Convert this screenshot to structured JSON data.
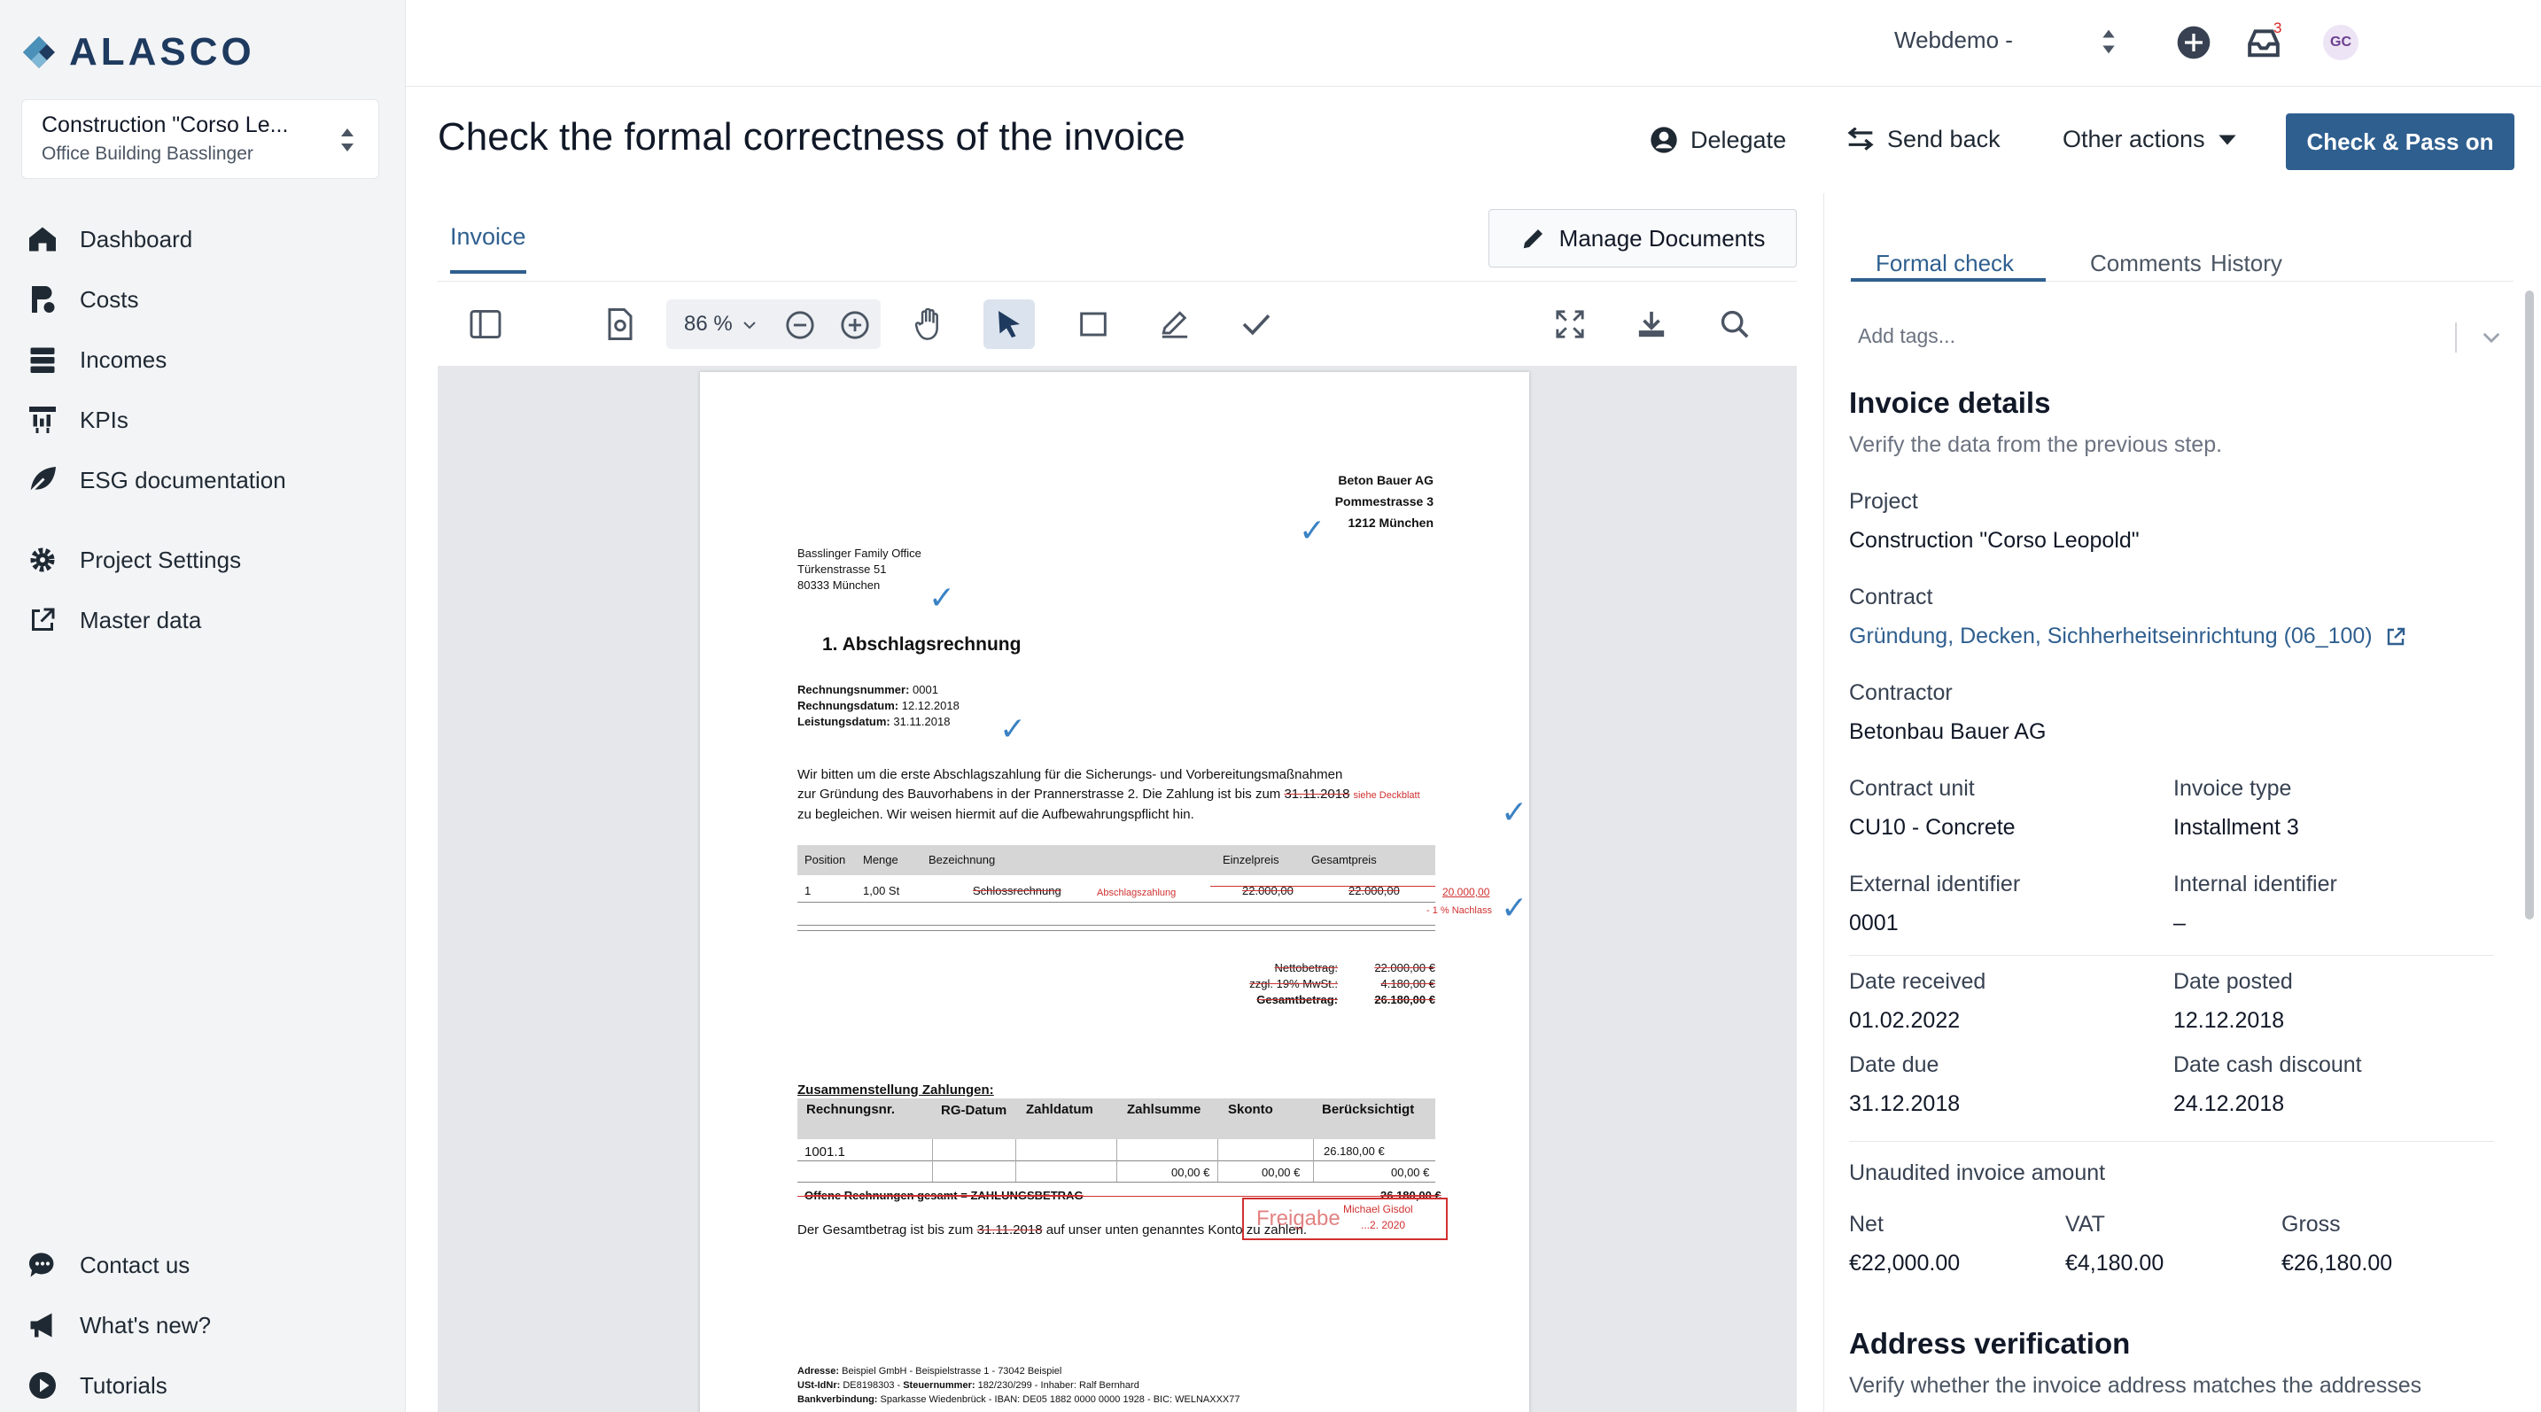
{
  "app": {
    "logo_text": "ALASCO"
  },
  "project": {
    "title": "Construction \"Corso Le...",
    "subtitle": "Office Building Basslinger"
  },
  "nav": {
    "dashboard": "Dashboard",
    "costs": "Costs",
    "incomes": "Incomes",
    "kpis": "KPIs",
    "esg": "ESG documentation",
    "settings": "Project Settings",
    "master": "Master data",
    "contact": "Contact us",
    "whatsnew": "What's new?",
    "tutorials": "Tutorials"
  },
  "topbar": {
    "workspace": "Webdemo -",
    "notification_count": "3",
    "avatar_initials": "GC"
  },
  "header": {
    "title": "Check the formal correctness of the invoice",
    "delegate": "Delegate",
    "send_back": "Send back",
    "other_actions": "Other actions",
    "primary": "Check & Pass on"
  },
  "doc": {
    "tab": "Invoice",
    "manage": "Manage Documents",
    "zoom": "86 %"
  },
  "invoice": {
    "sender": [
      "Beton Bauer AG",
      "Pommestrasse 3",
      "1212 München"
    ],
    "recipient": [
      "Basslinger Family Office",
      "Türkenstrasse 51",
      "80333 München"
    ],
    "heading": "1.  Abschlagsrechnung",
    "meta": [
      {
        "k": "Rechnungsnummer:",
        "v": " 0001"
      },
      {
        "k": "Rechnungsdatum:",
        "v": " 12.12.2018"
      },
      {
        "k": "Leistungsdatum:",
        "v": " 31.11.2018"
      }
    ],
    "body": [
      "Wir bitten um die erste Abschlagszahlung für die Sicherungs- und Vorbereitungsmaßnahmen",
      "zur Gründung des Bauvorhabens in der Prannerstrasse 2. Die Zahlung ist bis zum ",
      "zu begleichen. Wir weisen hiermit auf die Aufbewahrungspflicht hin."
    ],
    "due_struck": "31.11.2018",
    "note_deckblatt": "siehe Deckblatt",
    "table_headers": [
      "Position",
      "Menge",
      "Bezeichnung",
      "Einzelpreis",
      "Gesamtpreis"
    ],
    "row": [
      "1",
      "1,00 St",
      "Schlossrechnung",
      "22.000,00",
      "22.000,00"
    ],
    "row_annot": "Abschlagszahlung",
    "corr_amount": "20.000,00",
    "corr_note": "- 1 % Nachlass",
    "totals": [
      {
        "k": "Nettobetrag:",
        "v": "22.000,00 €"
      },
      {
        "k": "zzgl. 19% MwSt.:",
        "v": "4.180,00 €"
      },
      {
        "k": "Gesamtbetrag:",
        "v": "26.180,00 €"
      }
    ],
    "summary_title": "Zusammenstellung Zahlungen:",
    "summary_headers": [
      "Rechnungsnr.",
      "RG-Datum",
      "Zahldatum",
      "Zahlsumme",
      "Skonto",
      "Berücksichtigt"
    ],
    "summary_row1": [
      "1001.1",
      "26.180,00 €"
    ],
    "summary_row2": [
      "00,00 €",
      "00,00 €",
      "00,00 €"
    ],
    "open_total_label": "Offene Rechnungen gesamt = ZAHLUNGSBETRAG",
    "open_total_value": "26.180,00 €",
    "closing_1": "Der Gesamtbetrag ist bis zum ",
    "closing_date": "31.11.2018",
    "closing_2": " auf unser unten genanntes Konto zu zahlen.",
    "stamp": "Freigabe",
    "stamp_name": "Michael Gisdol",
    "stamp_date": "...2. 2020",
    "footer": [
      {
        "k": "Adresse:",
        "v": " Beispiel GmbH - Beispielstrasse 1 - 73042 Beispiel"
      },
      {
        "k": "USt-IdNr:",
        "v": " DE8198303 - "
      },
      {
        "k": "Bankverbindung:",
        "v": " Sparkasse Wiedenbrück - IBAN: DE05 1882 0000 0000 1928 - BIC: WELNAXXX77"
      }
    ],
    "footer_tax_k": "Steuernummer:",
    "footer_tax_v": " 182/230/299 - Inhaber: Ralf Bernhard"
  },
  "panel": {
    "tabs": [
      "Formal check",
      "Comments",
      "History"
    ],
    "tags_placeholder": "Add tags...",
    "details_title": "Invoice details",
    "details_sub": "Verify the data from the previous step.",
    "project_label": "Project",
    "project_value": "Construction \"Corso Leopold\"",
    "contract_label": "Contract",
    "contract_value": "Gründung, Decken, Sichherheitseinrichtung (06_100)",
    "contractor_label": "Contractor",
    "contractor_value": "Betonbau Bauer AG",
    "unit_label": "Contract unit",
    "unit_value": "CU10 - Concrete",
    "type_label": "Invoice type",
    "type_value": "Installment 3",
    "ext_label": "External identifier",
    "ext_value": "0001",
    "int_label": "Internal identifier",
    "int_value": "–",
    "received_label": "Date received",
    "received_value": "01.02.2022",
    "posted_label": "Date posted",
    "posted_value": "12.12.2018",
    "due_label": "Date due",
    "due_value": "31.12.2018",
    "cash_label": "Date cash discount",
    "cash_value": "24.12.2018",
    "amount_label": "Unaudited invoice amount",
    "net_label": "Net",
    "net_value": "€22,000.00",
    "vat_label": "VAT",
    "vat_value": "€4,180.00",
    "gross_label": "Gross",
    "gross_value": "€26,180.00",
    "address_title": "Address verification",
    "address_sub": "Verify whether the invoice address matches the addresses"
  }
}
